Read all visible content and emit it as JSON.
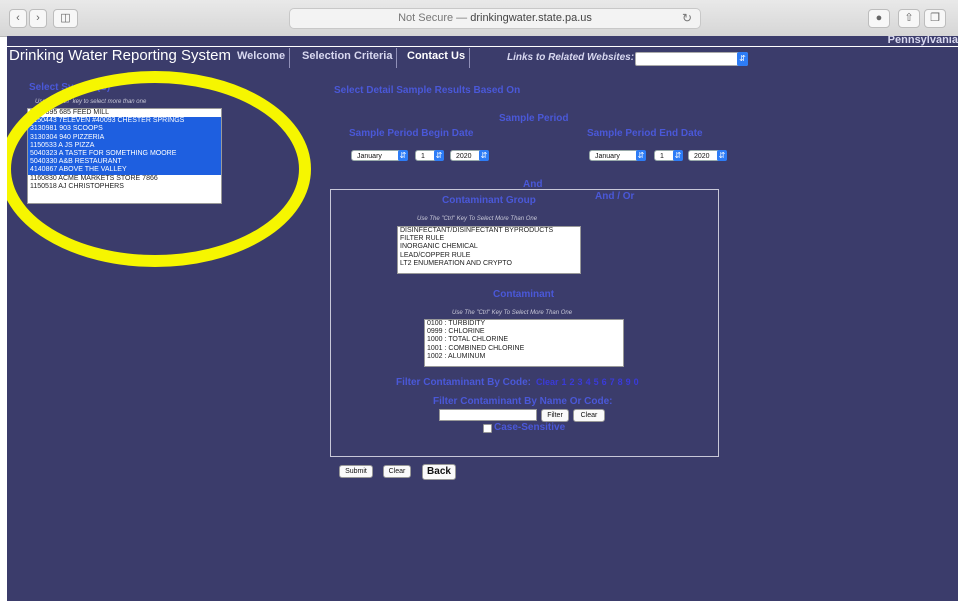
{
  "browser": {
    "address_prefix": "Not Secure — ",
    "address_domain": "drinkingwater.state.pa.us"
  },
  "nav": {
    "app_title": "Drinking Water Reporting System",
    "welcome": "Welcome",
    "selection_criteria": "Selection Criteria",
    "contact_us": "Contact Us",
    "links_label": "Links to Related Websites:",
    "state_text": "Pennsylvania"
  },
  "left": {
    "heading": "Select System(S)",
    "hint": "Use the \"Ctrl\" key to select more than one",
    "systems": [
      {
        "label": "5040395 685 FEED MILL",
        "selected": false
      },
      {
        "label": "1150443 7ELEVEN #40093 CHESTER SPRINGS",
        "selected": true
      },
      {
        "label": "3130981 903 SCOOPS",
        "selected": true
      },
      {
        "label": "3130304 940 PIZZERIA",
        "selected": true
      },
      {
        "label": "1150533 A JS PIZZA",
        "selected": true
      },
      {
        "label": "5040323 A TASTE FOR SOMETHING MOORE",
        "selected": true
      },
      {
        "label": "5040330 A&B RESTAURANT",
        "selected": true
      },
      {
        "label": "4140867 ABOVE THE VALLEY",
        "selected": true
      },
      {
        "label": "1160830 ACME MARKETS STORE 7866",
        "selected": false
      },
      {
        "label": "1150518 AJ CHRISTOPHERS",
        "selected": false
      }
    ]
  },
  "main": {
    "select_detail": "Select Detail Sample Results Based On",
    "sample_period": "Sample Period",
    "begin_label": "Sample Period Begin Date",
    "end_label": "Sample Period End Date",
    "begin": {
      "month": "January",
      "day": "1",
      "year": "2020"
    },
    "end": {
      "month": "January",
      "day": "1",
      "year": "2020"
    },
    "and": "And",
    "and_or": "And / Or",
    "contaminant_group_label": "Contaminant Group",
    "group_hint": "Use The \"Ctrl\" Key To Select More Than One",
    "groups": [
      "DISINFECTANT/DISINFECTANT BYPRODUCTS",
      "FILTER RULE",
      "INORGANIC CHEMICAL",
      "LEAD/COPPER RULE",
      "LT2 ENUMERATION AND CRYPTO"
    ],
    "contaminant_label": "Contaminant",
    "contaminant_hint": "Use The \"Ctrl\" Key To Select More Than One",
    "contaminants": [
      "0100 : TURBIDITY",
      "0999 : CHLORINE",
      "1000 : TOTAL CHLORINE",
      "1001 : COMBINED CHLORINE",
      "1002 : ALUMINUM"
    ],
    "filter_by_code_label": "Filter Contaminant By Code:",
    "filter_codes": [
      "Clear",
      "1",
      "2",
      "3",
      "4",
      "5",
      "6",
      "7",
      "8",
      "9",
      "0"
    ],
    "filter_by_name_label": "Filter Contaminant By Name Or Code:",
    "filter_button": "Filter",
    "clear_button": "Clear",
    "case_sensitive": "Case-Sensitive",
    "submit": "Submit",
    "clear": "Clear",
    "back": "Back"
  },
  "colors": {
    "page_bg": "#3b3c6b",
    "label_blue": "#4a58d8",
    "selection_blue": "#1e5fe0",
    "highlight_yellow": "#f6f600"
  }
}
